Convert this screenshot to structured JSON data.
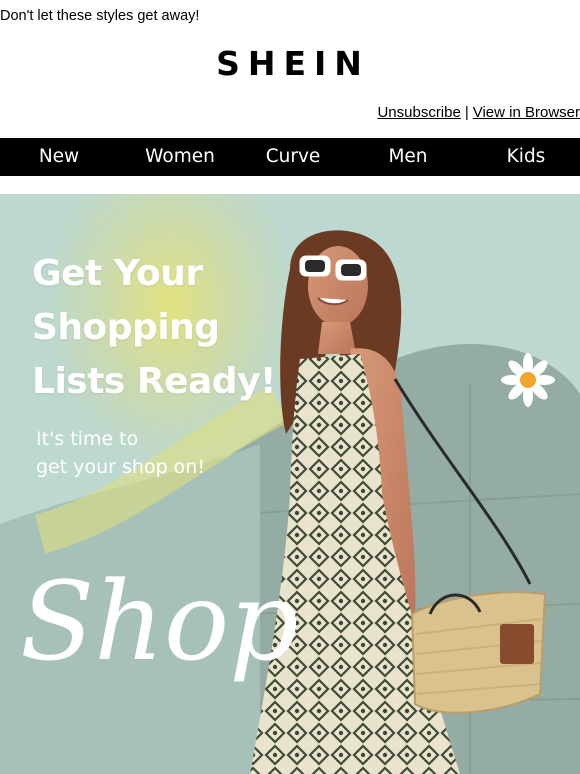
{
  "preheader": "Don't let these styles get away!",
  "brand": {
    "logo_text": "SHEIN"
  },
  "header_links": {
    "unsubscribe": "Unsubscribe",
    "separator": "|",
    "view_in_browser": "View in Browser"
  },
  "nav": {
    "items": [
      {
        "label": "New"
      },
      {
        "label": "Women"
      },
      {
        "label": "Curve"
      },
      {
        "label": "Men"
      },
      {
        "label": "Kids"
      }
    ]
  },
  "hero": {
    "headline_lines": [
      "Get Your",
      "Shopping",
      "Lists Ready!"
    ],
    "subtext_lines": [
      "It's time to",
      "get your shop on!"
    ],
    "script_word": "Shop",
    "colors": {
      "background": "#b9d6cf",
      "accent_yellow": "#e4e27a",
      "text": "#ffffff"
    }
  }
}
